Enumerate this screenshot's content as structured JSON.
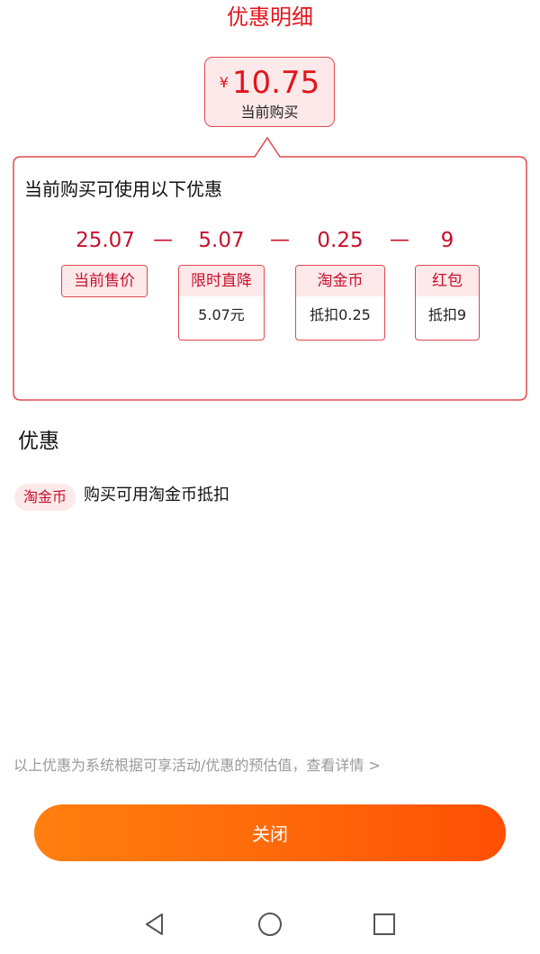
{
  "header": {
    "title": "优惠明细"
  },
  "current_price": {
    "currency": "¥",
    "amount": "10.75",
    "caption": "当前购买"
  },
  "breakdown": {
    "heading": "当前购买可使用以下优惠",
    "numbers": [
      "25.07",
      "5.07",
      "0.25",
      "9"
    ],
    "operators": [
      "—",
      "—",
      "—"
    ],
    "chips": [
      {
        "label": "当前售价",
        "detail": ""
      },
      {
        "label": "限时直降",
        "detail": "5.07元"
      },
      {
        "label": "淘金币",
        "detail": "抵扣0.25"
      },
      {
        "label": "红包",
        "detail": "抵扣9"
      }
    ]
  },
  "discounts_section": {
    "title": "优惠",
    "items": [
      {
        "badge": "淘金币",
        "description": "购买可用淘金币抵扣"
      }
    ]
  },
  "footnote": "以上优惠为系统根据可享活动/优惠的预估值，查看详情 >",
  "close_button": {
    "label": "关闭"
  },
  "navbar": {
    "icons": [
      "back-icon",
      "home-icon",
      "recents-icon"
    ]
  },
  "colors": {
    "accent_red": "#e4141b",
    "chip_border": "#e0484f",
    "chip_fill": "#fde9e9",
    "button_start": "#ff7f0f",
    "button_end": "#ff4f05"
  }
}
